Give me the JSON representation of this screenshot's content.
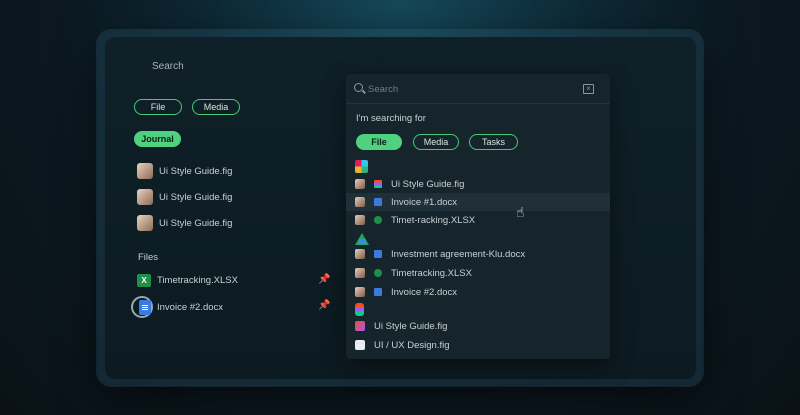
{
  "left": {
    "search_label": "Search",
    "filters": [
      "File",
      "Media"
    ],
    "journal_chip": "Journal",
    "recent_items": [
      {
        "label": "Ui Style Guide.fig"
      },
      {
        "label": "Ui Style Guide.fig"
      },
      {
        "label": "Ui Style Guide.fig"
      }
    ],
    "files_heading": "Files",
    "files": [
      {
        "label": "Timetracking.XLSX",
        "icon": "excel-icon"
      },
      {
        "label": "Invoice #2.docx",
        "icon": "doc-icon"
      }
    ]
  },
  "dropdown": {
    "search_placeholder": "Search",
    "searching_for": "I'm searching for",
    "filters": [
      {
        "label": "File",
        "active": true
      },
      {
        "label": "Media",
        "active": false
      },
      {
        "label": "Tasks",
        "active": false
      }
    ],
    "groups": [
      {
        "app": "slack-icon",
        "items": [
          {
            "label": "Ui Style Guide.fig",
            "icon": "figma-icon"
          },
          {
            "label": "Invoice #1.docx",
            "icon": "doc-icon"
          },
          {
            "label": "Timet-racking.XLSX",
            "icon": "excel-icon"
          }
        ]
      },
      {
        "app": "google-drive-icon",
        "items": [
          {
            "label": "Investment agreement-Klu.docx",
            "icon": "doc-icon"
          },
          {
            "label": "Timetracking.XLSX",
            "icon": "excel-icon"
          },
          {
            "label": "Invoice #2.docx",
            "icon": "doc-icon"
          }
        ]
      },
      {
        "app": "figma-icon",
        "items": [
          {
            "label": "Ui Style Guide.fig"
          },
          {
            "label": "UI / UX Design.fig"
          }
        ]
      }
    ]
  },
  "colors": {
    "accent": "#4fd180",
    "background": "#0c1b21",
    "dropdown": "#16242b"
  }
}
